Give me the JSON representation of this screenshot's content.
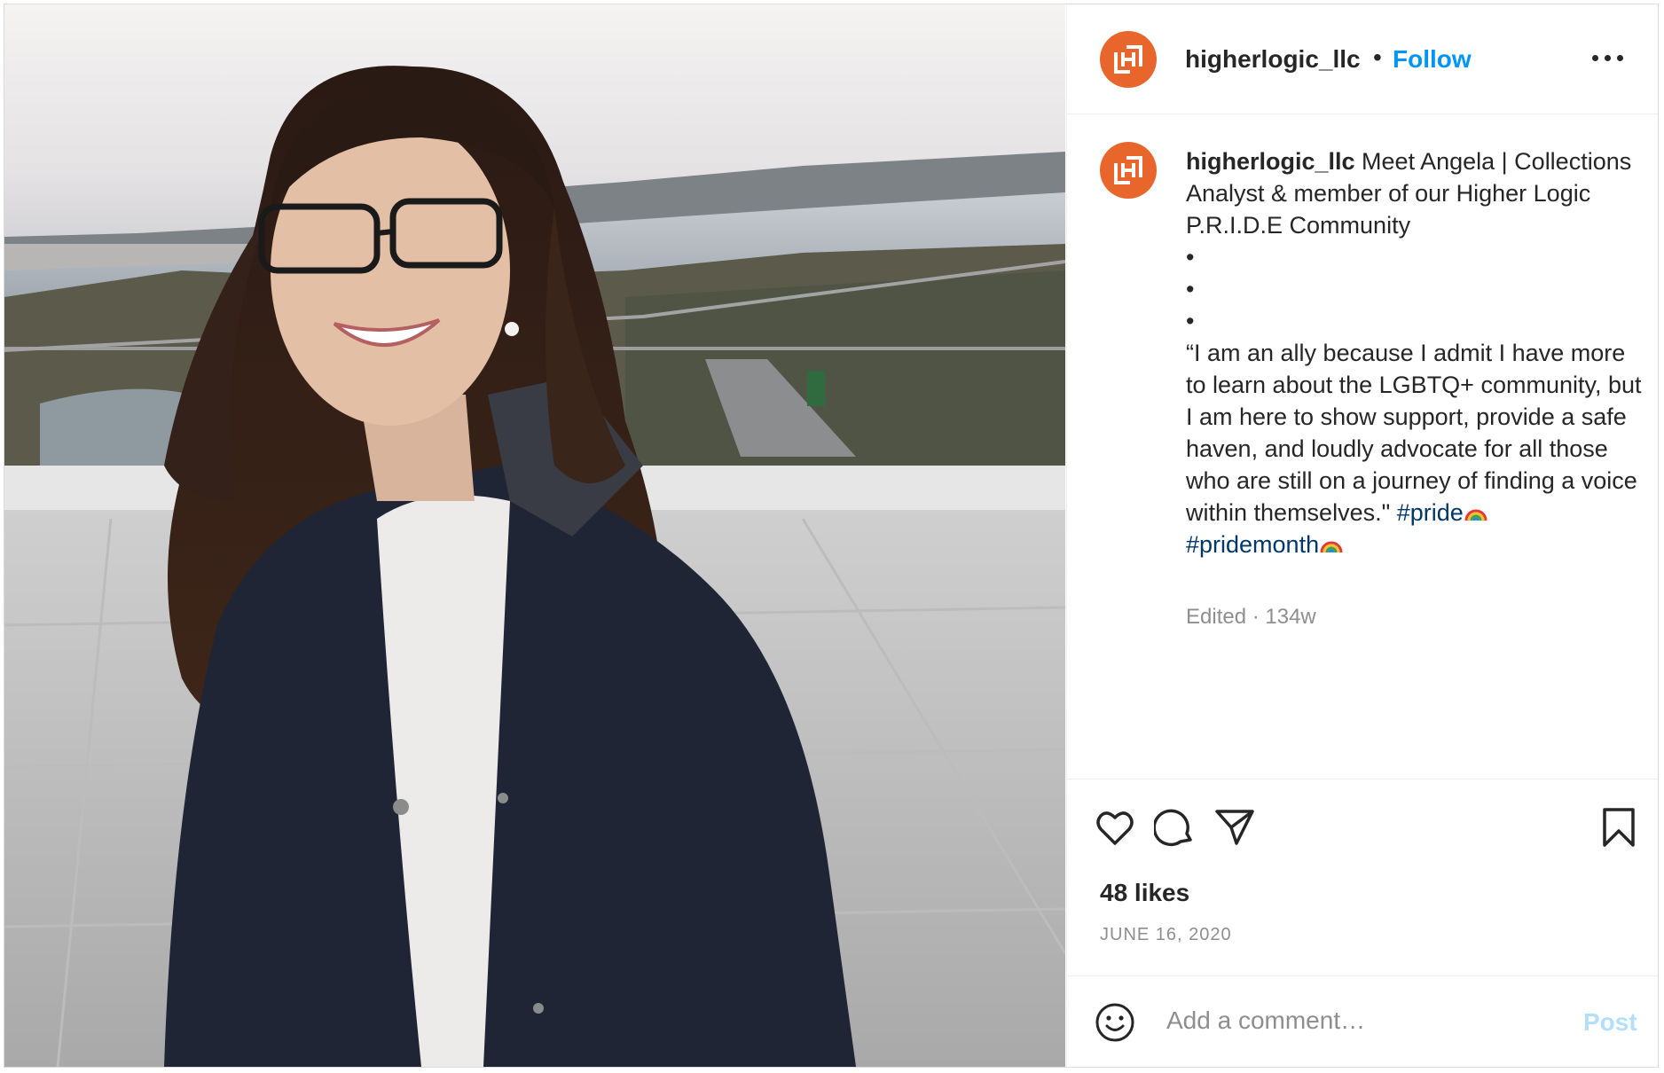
{
  "post": {
    "username": "higherlogic_llc",
    "separator": "•",
    "follow_label": "Follow",
    "more_icon": "more-options-icon",
    "avatar_color": "#e8652c"
  },
  "caption": {
    "username": "higherlogic_llc",
    "text": " Meet Angela | Collections Analyst & member of our Higher Logic P.R.I.D.E Community\n•\n•\n•\n“I am an ally because I admit I have more to learn about the LGBTQ+ community, but I am here to show support, provide a safe haven, and loudly advocate for all those who are still on a journey of finding a voice within themselves.\" ",
    "hashtag1": "#pride",
    "hashtag2": "#pridemonth",
    "emoji": "rainbow-emoji",
    "meta": "Edited · 134w"
  },
  "actions": {
    "like_icon": "heart-icon",
    "comment_icon": "comment-icon",
    "share_icon": "share-icon",
    "save_icon": "bookmark-icon",
    "likes": "48 likes",
    "date": "JUNE 16, 2020"
  },
  "comment": {
    "emoji_icon": "smiley-icon",
    "placeholder": "Add a comment…",
    "post_label": "Post",
    "post_color": "#b2dffc"
  },
  "colors": {
    "link": "#0095f6",
    "hashtag": "#00376b",
    "muted": "#8e8e8e"
  }
}
